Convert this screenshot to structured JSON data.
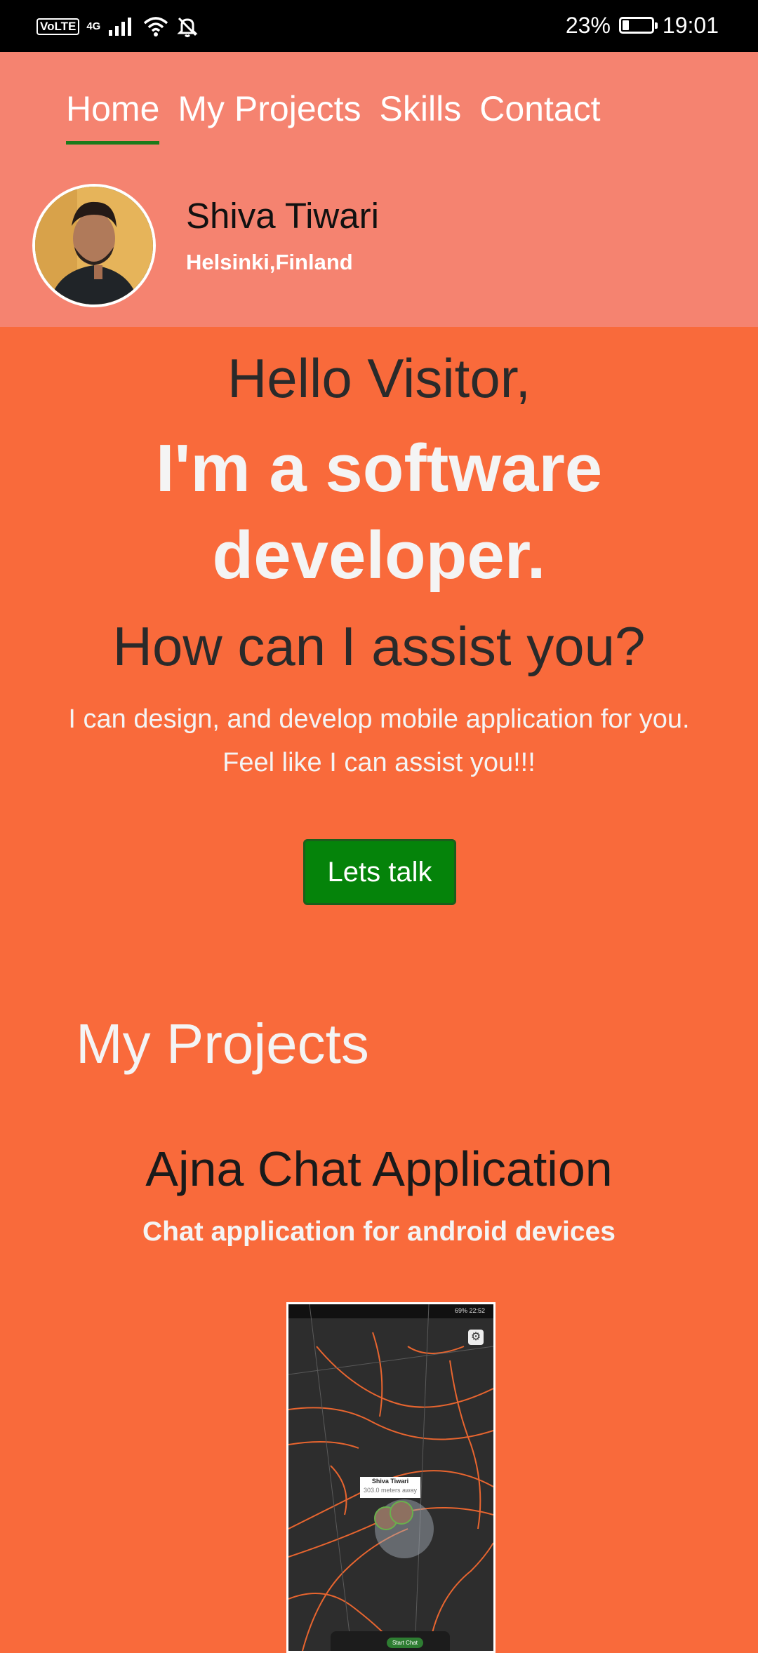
{
  "status_bar": {
    "volte": "VoLTE",
    "network": "4G",
    "battery_text": "23%",
    "battery_level": 0.23,
    "time": "19:01",
    "icons": [
      "signal-icon",
      "wifi-icon",
      "bell-off-icon",
      "battery-icon"
    ]
  },
  "nav": {
    "items": [
      "Home",
      "My Projects",
      "Skills",
      "Contact"
    ],
    "active": "Home"
  },
  "profile": {
    "name": "Shiva Tiwari",
    "location": "Helsinki,Finland"
  },
  "hero": {
    "greeting": "Hello Visitor,",
    "headline": "I'm a software developer.",
    "question": "How can I assist you?",
    "description": "I can design, and develop mobile application for you. Feel like I can assist you!!!",
    "cta": "Lets talk"
  },
  "projects": {
    "title": "My Projects",
    "items": [
      {
        "title": "Ajna Chat Application",
        "subtitle": "Chat application for android devices",
        "screenshot": {
          "status_left": "",
          "status_right": "69%  22:52",
          "callout_name": "Shiva Tiwari",
          "callout_distance": "303.0 meters away",
          "button": "Start Chat"
        }
      }
    ]
  },
  "colors": {
    "background": "#F96A3B",
    "header": "#F58370",
    "cta": "#05830A",
    "nav_underline": "#1C7A1A"
  }
}
